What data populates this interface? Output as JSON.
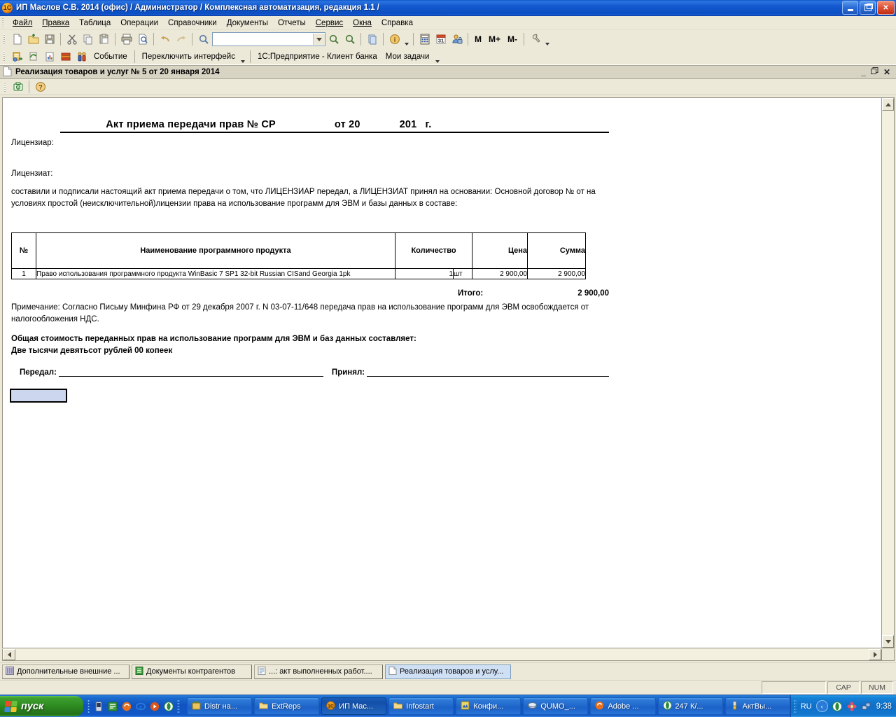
{
  "window": {
    "title": "ИП Маслов С.В. 2014 (офис) / Администратор / Комплексная автоматизация, редакция 1.1 /",
    "app_icon": "app-1c-icon",
    "minimize_label": "_",
    "maximize_label": "❐",
    "close_label": "✕"
  },
  "menubar": {
    "items": [
      {
        "label": "Файл",
        "mnemonic": "Ф"
      },
      {
        "label": "Правка",
        "mnemonic": "П"
      },
      {
        "label": "Таблица",
        "mnemonic": ""
      },
      {
        "label": "Операции",
        "mnemonic": ""
      },
      {
        "label": "Справочники",
        "mnemonic": ""
      },
      {
        "label": "Документы",
        "mnemonic": ""
      },
      {
        "label": "Отчеты",
        "mnemonic": ""
      },
      {
        "label": "Сервис",
        "mnemonic": "С"
      },
      {
        "label": "Окна",
        "mnemonic": "О"
      },
      {
        "label": "Справка",
        "mnemonic": ""
      }
    ]
  },
  "toolbar1": {
    "icons": [
      "new-document-icon",
      "open-folder-icon",
      "save-diskette-icon",
      "cut-scissors-icon",
      "copy-icon",
      "paste-clipboard-icon",
      "print-icon",
      "print-preview-icon",
      "undo-arrow-icon",
      "redo-arrow-icon",
      "find-magnifier-icon"
    ],
    "search_value": "",
    "search_placeholder": "",
    "after_icons": [
      "find-next-icon",
      "find-prev-icon",
      "copy-link-icon",
      "info-icon"
    ],
    "right_icons": [
      "calculator-icon",
      "calendar-icon",
      "user-accounts-icon"
    ],
    "memory_buttons": [
      "M",
      "M+",
      "M-"
    ],
    "settings_icon": "tools-wrench-icon"
  },
  "toolbar2": {
    "icons": [
      "active-users-icon",
      "refresh-icon",
      "report-chart-icon",
      "books-icon",
      "people-icon"
    ],
    "links": [
      "Событие",
      "Переключить интерфейс",
      "1С:Предприятие - Клиент банка",
      "Мои задачи"
    ]
  },
  "mdi": {
    "title": "Реализация товаров и услуг № 5 от 20 января 2014",
    "doc_icon": "document-icon",
    "minimize": "_",
    "restore": "❐",
    "close": "✕",
    "toolbar_icons": [
      "save-print-form-icon",
      "help-question-icon"
    ]
  },
  "document": {
    "heading": {
      "title": "Акт приема передачи прав № СР",
      "date_prefix": "от 20",
      "year": "201",
      "year_suffix": "г."
    },
    "licensor_label": "Лицензиар:",
    "licensor_value": "",
    "licensee_label": "Лицензиат:",
    "licensee_value": "",
    "preamble": "составили и подписали настоящий акт приема передачи о том, что ЛИЦЕНЗИАР передал, а ЛИЦЕНЗИАТ принял на основании: Основной договор №   от   на условиях простой (неисключительной)лицензии права на использование программ для ЭВМ и базы данных в составе:",
    "table": {
      "headers": [
        "№",
        "Наименование программного продукта",
        "Количество",
        "Цена",
        "Сумма"
      ],
      "rows": [
        {
          "num": "1",
          "name": "Право использования программного продукта WinBasic 7 SP1 32-bit Russian CISand Georgia 1pk",
          "qty": "1",
          "unit": "шт",
          "price": "2 900,00",
          "sum": "2 900,00"
        }
      ],
      "total_label": "Итого:",
      "total_value": "2 900,00"
    },
    "note": "Примечание: Согласно Письму Минфина РФ от 29 декабря 2007 г. N 03-07-11/648 передача прав на использование программ для ЭВМ освобождается от налогообложения НДС.",
    "total_line1": "Общая стоимость переданных прав на использование программ для ЭВМ и баз данных составляет:",
    "total_line2": "Две тысячи девятьсот рублей 00 копеек",
    "signatures": {
      "transferred_label": "Передал:",
      "accepted_label": "Принял:"
    }
  },
  "windowlist": {
    "items": [
      {
        "label": "Дополнительные внешние ...",
        "icon": "external-processing-icon",
        "active": false
      },
      {
        "label": "Документы контрагентов",
        "icon": "green-document-icon",
        "active": false
      },
      {
        "label": "...: акт выполненных работ....",
        "icon": "report-document-icon",
        "active": false
      },
      {
        "label": "Реализация товаров и услу...",
        "icon": "document-icon",
        "active": true
      }
    ]
  },
  "statusbar": {
    "panes": [
      "",
      "CAP",
      "NUM"
    ]
  },
  "taskbar": {
    "start_label": "пуск",
    "quick_launch": [
      "media-player-icon",
      "green-note-icon",
      "firefox-icon",
      "internet-explorer-icon",
      "media-icon",
      "opera-icon"
    ],
    "tasks": [
      {
        "label": "Distr на...",
        "icon": "archive-icon",
        "active": false
      },
      {
        "label": "ExtReps",
        "icon": "folder-icon",
        "active": false
      },
      {
        "label": "ИП Мас...",
        "icon": "app-1c-icon",
        "active": true
      },
      {
        "label": "Infostart",
        "icon": "folder-icon",
        "active": false
      },
      {
        "label": "Конфи...",
        "icon": "config-icon",
        "active": false
      },
      {
        "label": "QUMO_...",
        "icon": "drive-icon",
        "active": false
      },
      {
        "label": "Adobe ...",
        "icon": "firefox-icon",
        "active": false
      },
      {
        "label": "247 К/...",
        "icon": "opera-icon",
        "active": false
      },
      {
        "label": "АктВы...",
        "icon": "brush-icon",
        "active": false
      }
    ],
    "tray": {
      "language": "RU",
      "icons": [
        "show-hidden-icon",
        "opera-tray-icon",
        "flower-icon",
        "network-icon"
      ],
      "clock": "9:38"
    }
  }
}
